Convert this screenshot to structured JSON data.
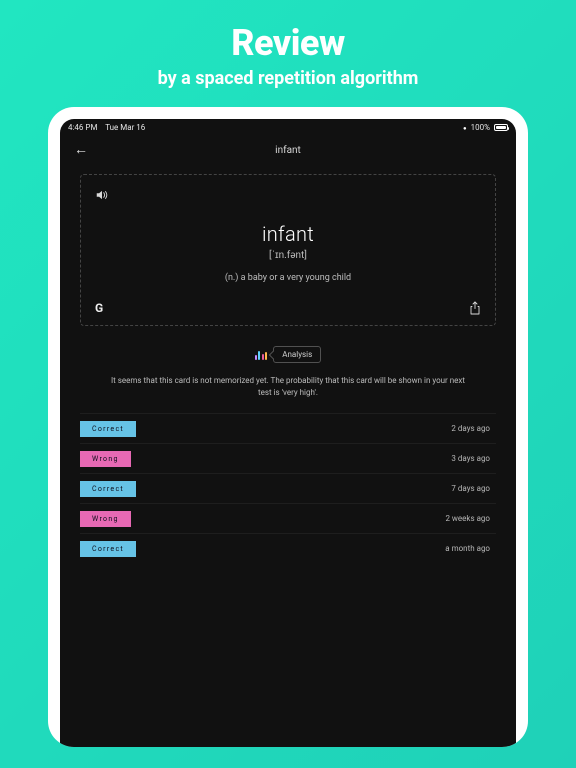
{
  "promo": {
    "title": "Review",
    "subtitle": "by a spaced repetition algorithm"
  },
  "statusbar": {
    "time": "4:46 PM",
    "date": "Tue Mar 16",
    "battery": "100%"
  },
  "nav": {
    "title": "infant"
  },
  "card": {
    "word": "infant",
    "ipa": "[ˈɪn.fənt]",
    "definition": "(n.) a baby or a very young child"
  },
  "analysis": {
    "label": "Analysis"
  },
  "summary": "It seems that this card is not memorized yet. The probability that this card will be shown in your next test is 'very high'.",
  "history": [
    {
      "result": "Correct",
      "kind": "correct",
      "when": "2 days ago"
    },
    {
      "result": "Wrong",
      "kind": "wrong",
      "when": "3 days ago"
    },
    {
      "result": "Correct",
      "kind": "correct",
      "when": "7 days ago"
    },
    {
      "result": "Wrong",
      "kind": "wrong",
      "when": "2 weeks ago"
    },
    {
      "result": "Correct",
      "kind": "correct",
      "when": "a month ago"
    }
  ],
  "labels": {
    "result_correct": "Correct",
    "result_wrong": "Wrong"
  }
}
